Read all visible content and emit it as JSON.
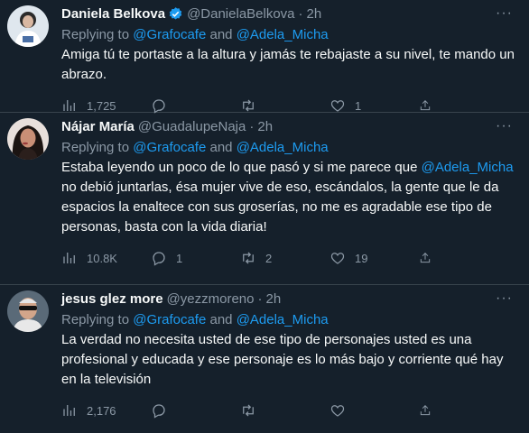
{
  "tweets": [
    {
      "name": "Daniela Belkova",
      "handle": "@DanielaBelkova",
      "dot": "·",
      "time": "2h",
      "replying_prefix": "Replying to ",
      "mention1": "@Grafocafe",
      "and": " and ",
      "mention2": "@Adela_Micha",
      "text": "Amiga tú te portaste a la altura y jamás te rebajaste a su nivel, te mando un abrazo.",
      "views": "1,725",
      "replies": "",
      "retweets": "",
      "likes": "1"
    },
    {
      "name": "Nájar María",
      "handle": "@GuadalupeNaja",
      "dot": "·",
      "time": "2h",
      "replying_prefix": "Replying to ",
      "mention1": "@Grafocafe",
      "and": " and ",
      "mention2": "@Adela_Micha",
      "text_before": "Estaba leyendo un poco de lo que pasó y si me parece que ",
      "text_mention": "@Adela_Micha",
      "text_after": " no debió juntarlas, ésa mujer vive de eso, escándalos, la gente que le da espacios la enaltece con sus groserías, no me es agradable ese tipo de personas, basta con la vida diaria!",
      "views": "10.8K",
      "replies": "1",
      "retweets": "2",
      "likes": "19"
    },
    {
      "name": "jesus glez more",
      "handle": "@yezzmoreno",
      "dot": "·",
      "time": "2h",
      "replying_prefix": "Replying to ",
      "mention1": "@Grafocafe",
      "and": " and ",
      "mention2": "@Adela_Micha",
      "text": "La verdad no necesita usted de ese tipo de personajes usted es una profesional y educada y ese personaje es lo más bajo y corriente qué hay en la televisión",
      "views": "2,176",
      "replies": "",
      "retweets": "",
      "likes": ""
    }
  ],
  "ui": {
    "more": "···"
  },
  "colors": {
    "background": "#15202b",
    "accent": "#1d9bf0",
    "muted": "#8b98a5",
    "divider": "#38444d"
  },
  "icons": [
    "verified-badge-icon",
    "views-icon",
    "reply-icon",
    "retweet-icon",
    "like-icon",
    "share-icon",
    "more-icon"
  ]
}
